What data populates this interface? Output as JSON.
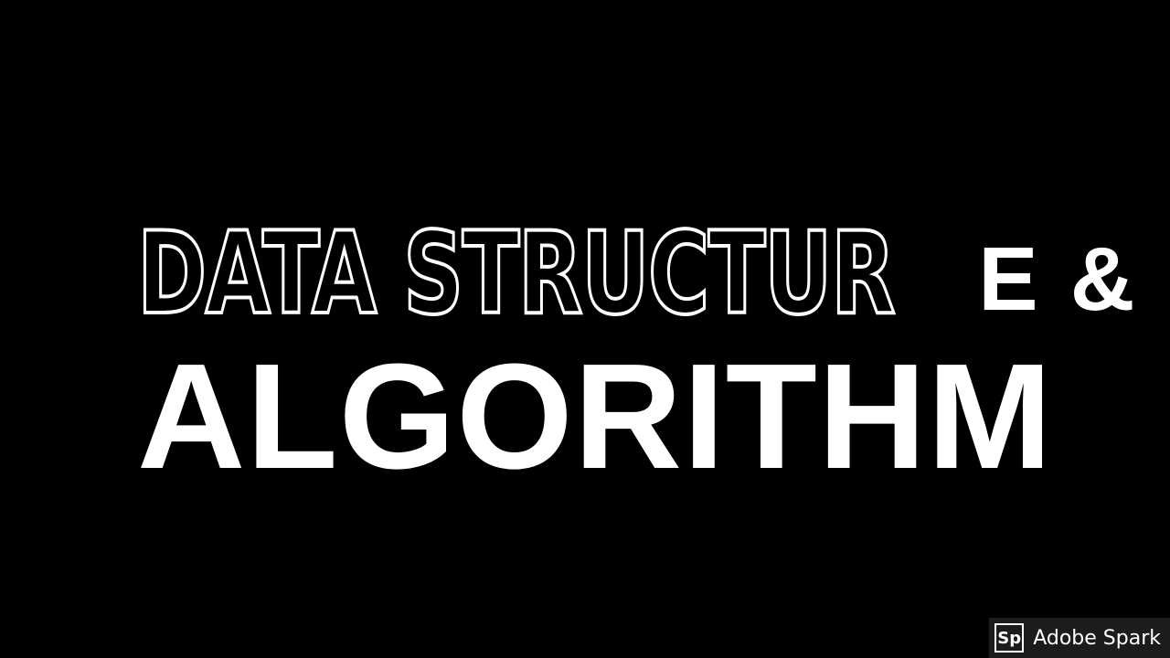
{
  "title": {
    "line1_outline": "DATA STRUCTUR",
    "line1_solid": "E &",
    "line2": "ALGORITHM"
  },
  "watermark": {
    "logo": "Sp",
    "text": "Adobe Spark"
  },
  "colors": {
    "background": "#000000",
    "text": "#ffffff",
    "watermark_bg": "#1c1c1c"
  }
}
